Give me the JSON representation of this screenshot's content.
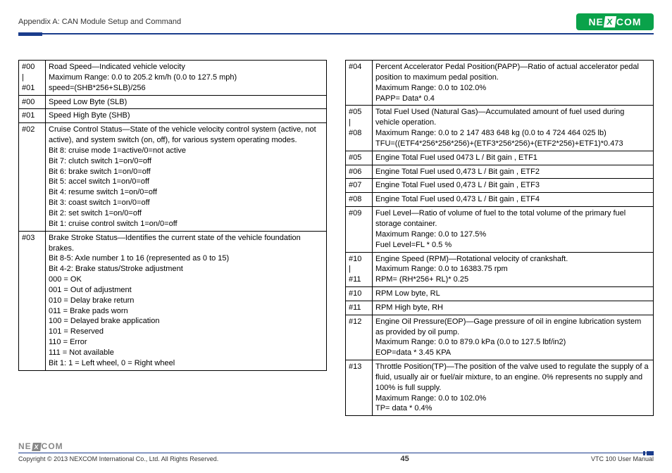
{
  "header": {
    "appendix": "Appendix A: CAN Module Setup and Command",
    "logo_text_left": "NE",
    "logo_text_x": "X",
    "logo_text_right": "COM"
  },
  "left_table": [
    {
      "idx": "#00\n|\n#01",
      "desc": "Road Speed—Indicated vehicle velocity\nMaximum Range: 0.0 to 205.2 km/h (0.0 to 127.5 mph)\nspeed=(SHB*256+SLB)/256"
    },
    {
      "idx": "#00",
      "desc": "Speed Low Byte (SLB)"
    },
    {
      "idx": "#01",
      "desc": "Speed High Byte (SHB)"
    },
    {
      "idx": "#02",
      "desc": "Cruise Control Status—State of the vehicle velocity control system (active, not active), and system switch (on, off), for various system operating modes.\nBit 8: cruise mode 1=active/0=not active\nBit 7: clutch switch 1=on/0=off\nBit 6: brake switch 1=on/0=off\nBit 5: accel switch 1=on/0=off\nBit 4: resume switch 1=on/0=off\nBit 3: coast switch 1=on/0=off\nBit 2: set switch 1=on/0=off\nBit 1: cruise control switch 1=on/0=off"
    },
    {
      "idx": "#03",
      "desc": "Brake Stroke Status—Identifies the current state of the vehicle foundation brakes.\nBit 8-5: Axle number 1 to 16 (represented as 0 to 15)\nBit 4-2: Brake status/Stroke adjustment\n000 = OK\n001 = Out of adjustment\n010 = Delay brake return\n011 = Brake pads worn\n100 = Delayed brake application\n101 = Reserved\n110 = Error\n111 = Not available\nBit 1: 1 = Left wheel, 0 = Right wheel"
    }
  ],
  "right_table": [
    {
      "idx": "#04",
      "desc": "Percent Accelerator Pedal Position(PAPP)—Ratio of actual accelerator pedal position to maximum pedal position.\nMaximum Range: 0.0 to 102.0%\nPAPP= Data* 0.4"
    },
    {
      "idx": "#05\n|\n#08",
      "desc": "Total Fuel Used (Natural Gas)—Accumulated amount of fuel used during vehicle operation.\nMaximum Range: 0.0 to 2 147 483 648 kg (0.0 to 4 724 464 025 lb)\nTFU=((ETF4*256*256*256)+(ETF3*256*256)+(ETF2*256)+ETF1)*0.473"
    },
    {
      "idx": "#05",
      "desc": "Engine Total Fuel used 0473 L / Bit gain , ETF1"
    },
    {
      "idx": "#06",
      "desc": "Engine Total Fuel used 0,473 L / Bit gain , ETF2"
    },
    {
      "idx": "#07",
      "desc": "Engine Total Fuel used 0,473 L / Bit gain , ETF3"
    },
    {
      "idx": "#08",
      "desc": "Engine Total Fuel used 0,473 L / Bit gain , ETF4"
    },
    {
      "idx": "#09",
      "desc": "Fuel Level—Ratio of volume of fuel to the total volume of the primary fuel storage container.\nMaximum Range: 0.0 to 127.5%\nFuel Level=FL * 0.5 %"
    },
    {
      "idx": "#10\n|\n#11",
      "desc": "Engine Speed (RPM)—Rotational velocity of crankshaft.\nMaximum Range: 0.0 to 16383.75 rpm\nRPM= (RH*256+ RL)* 0.25"
    },
    {
      "idx": "#10",
      "desc": "RPM Low byte, RL"
    },
    {
      "idx": "#11",
      "desc": "RPM High byte, RH"
    },
    {
      "idx": "#12",
      "desc": "Engine Oil Pressure(EOP)—Gage pressure of oil in engine lubrication system as provided by oil pump.\nMaximum Range: 0.0 to 879.0 kPa (0.0 to 127.5 lbf/in2)\nEOP=data * 3.45 KPA"
    },
    {
      "idx": "#13",
      "desc": "Throttle Position(TP)—The position of the valve used to regulate the supply of a fluid, usually air or fuel/air mixture, to an engine. 0% represents no supply and 100% is full supply.\nMaximum Range: 0.0 to 102.0%\nTP= data * 0.4%"
    }
  ],
  "footer": {
    "copyright": "Copyright © 2013 NEXCOM International Co., Ltd. All Rights Reserved.",
    "page": "45",
    "manual": "VTC 100 User Manual",
    "logo_left": "NE",
    "logo_x": "X",
    "logo_right": "COM"
  }
}
